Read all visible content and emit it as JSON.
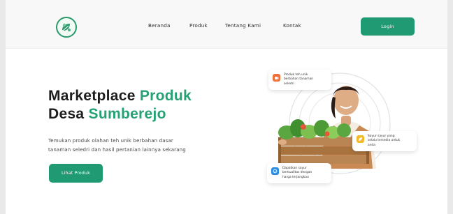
{
  "nav": {
    "links": [
      "Beranda",
      "Produk",
      "Tentang Kami",
      "Kontak"
    ],
    "login_label": "Login"
  },
  "hero": {
    "title_line1_dark": "Marketplace",
    "title_line1_accent": "Produk",
    "title_line2_dark": "Desa",
    "title_line2_accent": "Sumberejo",
    "description_line1": "Temukan produk olahan teh unik berbahan dasar",
    "description_line2": "tanaman seledri dan hasil pertanian lainnya sekarang",
    "cta_label": "Lihat Produk"
  },
  "features": [
    {
      "icon": "tea-icon",
      "color": "#f0703a",
      "text": "Produk teh unik berbahan tanaman seledri"
    },
    {
      "icon": "leaf-icon",
      "color": "#f3b928",
      "text": "Sayur sayur yang selalu tersedia untuk anda"
    },
    {
      "icon": "tag-icon",
      "color": "#2f8de0",
      "text": "Dapatkan sayur berkualitas dengan harga terjangkau"
    }
  ],
  "colors": {
    "brand_green": "#1f9a72",
    "accent_green": "#26a174"
  }
}
